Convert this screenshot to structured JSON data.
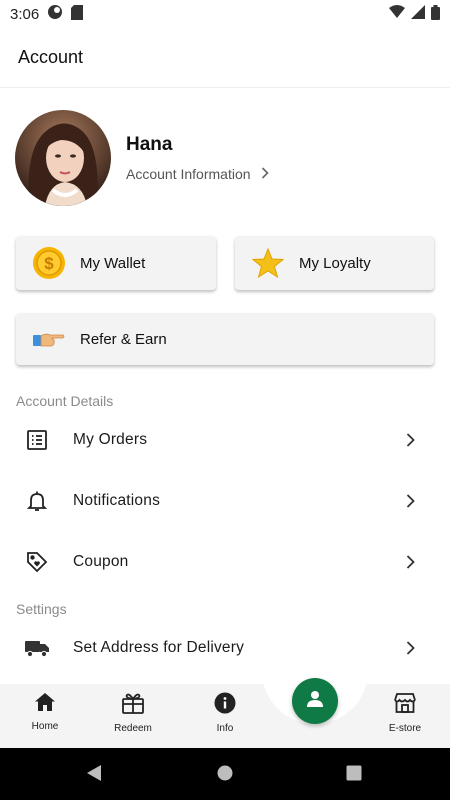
{
  "status_bar": {
    "time": "3:06",
    "icons": [
      "notification-dot-icon",
      "sim-card-icon",
      "wifi-icon",
      "signal-icon",
      "battery-icon"
    ]
  },
  "app_bar": {
    "title": "Account"
  },
  "profile": {
    "name": "Hana",
    "link_label": "Account Information"
  },
  "quick_actions": {
    "wallet_label": "My Wallet",
    "loyalty_label": "My Loyalty",
    "refer_label": "Refer & Earn"
  },
  "sections": {
    "account_details": {
      "header": "Account Details",
      "items": [
        {
          "label": "My Orders",
          "icon": "orders-list-icon"
        },
        {
          "label": "Notifications",
          "icon": "bell-icon"
        },
        {
          "label": "Coupon",
          "icon": "tag-heart-icon"
        }
      ]
    },
    "settings": {
      "header": "Settings",
      "items": [
        {
          "label": "Set Address for Delivery",
          "icon": "truck-icon"
        }
      ]
    }
  },
  "bottom_nav": {
    "items": [
      {
        "label": "Home",
        "icon": "home-icon"
      },
      {
        "label": "Redeem",
        "icon": "gift-icon"
      },
      {
        "label": "Info",
        "icon": "info-icon"
      },
      {
        "label": "E-store",
        "icon": "store-icon"
      }
    ],
    "active": "account",
    "fab_icon": "person-icon"
  },
  "colors": {
    "brand_green": "#0f7a45",
    "card_bg": "#f3f3f3",
    "section_header": "#8a8a8a",
    "coin_gold": "#f5b400",
    "star_gold": "#f3c01a"
  }
}
